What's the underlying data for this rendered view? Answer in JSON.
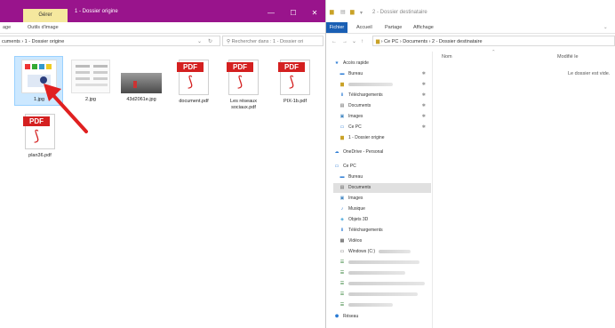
{
  "left_window": {
    "ribbon_context_tab": "Gérer",
    "title": "1 - Dossier origine",
    "controls": {
      "minimize": "—",
      "maximize": "☐",
      "close": "✕"
    },
    "ribbon_tabs": [
      "age",
      "Outils d'image"
    ],
    "address": "cuments › 1 - Dossier origine",
    "search_placeholder": "Rechercher dans : 1 - Dossier ori",
    "files": [
      {
        "name": "1.jpg",
        "kind": "image-doc",
        "selected": true
      },
      {
        "name": "2.jpg",
        "kind": "image-doc"
      },
      {
        "name": "43d2061e.jpg",
        "kind": "photo"
      },
      {
        "name": "document.pdf",
        "kind": "pdf"
      },
      {
        "name": "Les réseaux sociaux.pdf",
        "kind": "pdf"
      },
      {
        "name": "PIX-1b.pdf",
        "kind": "pdf"
      },
      {
        "name": "plan36.pdf",
        "kind": "pdf"
      }
    ],
    "pdf_badge": "PDF"
  },
  "right_window": {
    "title": "2 - Dossier destinataire",
    "ribbon_tabs": [
      "Fichier",
      "Accueil",
      "Partage",
      "Affichage"
    ],
    "breadcrumb": [
      "Ce PC",
      "Documents",
      "2 - Dossier destinataire"
    ],
    "quick_access": "Accès rapide",
    "nav_items": [
      {
        "label": "Bureau",
        "icon": "desktop-icon",
        "pinned": true
      },
      {
        "label": "",
        "icon": "folder-icon",
        "pinned": true,
        "blurred": true
      },
      {
        "label": "Téléchargements",
        "icon": "download-icon",
        "pinned": true
      },
      {
        "label": "Documents",
        "icon": "documents-icon",
        "pinned": true
      },
      {
        "label": "Images",
        "icon": "images-icon",
        "pinned": true
      },
      {
        "label": "Ce PC",
        "icon": "pc-icon",
        "pinned": true
      },
      {
        "label": "1 - Dossier origine",
        "icon": "folder-icon"
      }
    ],
    "onedrive": "OneDrive - Personal",
    "this_pc": "Ce PC",
    "pc_items": [
      {
        "label": "Bureau",
        "icon": "desktop-icon"
      },
      {
        "label": "Documents",
        "icon": "documents-icon",
        "selected": true
      },
      {
        "label": "Images",
        "icon": "images-icon"
      },
      {
        "label": "Musique",
        "icon": "music-icon"
      },
      {
        "label": "Objets 3D",
        "icon": "objects3d-icon"
      },
      {
        "label": "Téléchargements",
        "icon": "download-icon"
      },
      {
        "label": "Vidéos",
        "icon": "videos-icon"
      },
      {
        "label": "Windows (C:)",
        "icon": "drive-icon"
      }
    ],
    "network": "Réseau",
    "column_name": "Nom",
    "column_modified": "Modifié le",
    "empty_message": "Le dossier est vide."
  }
}
